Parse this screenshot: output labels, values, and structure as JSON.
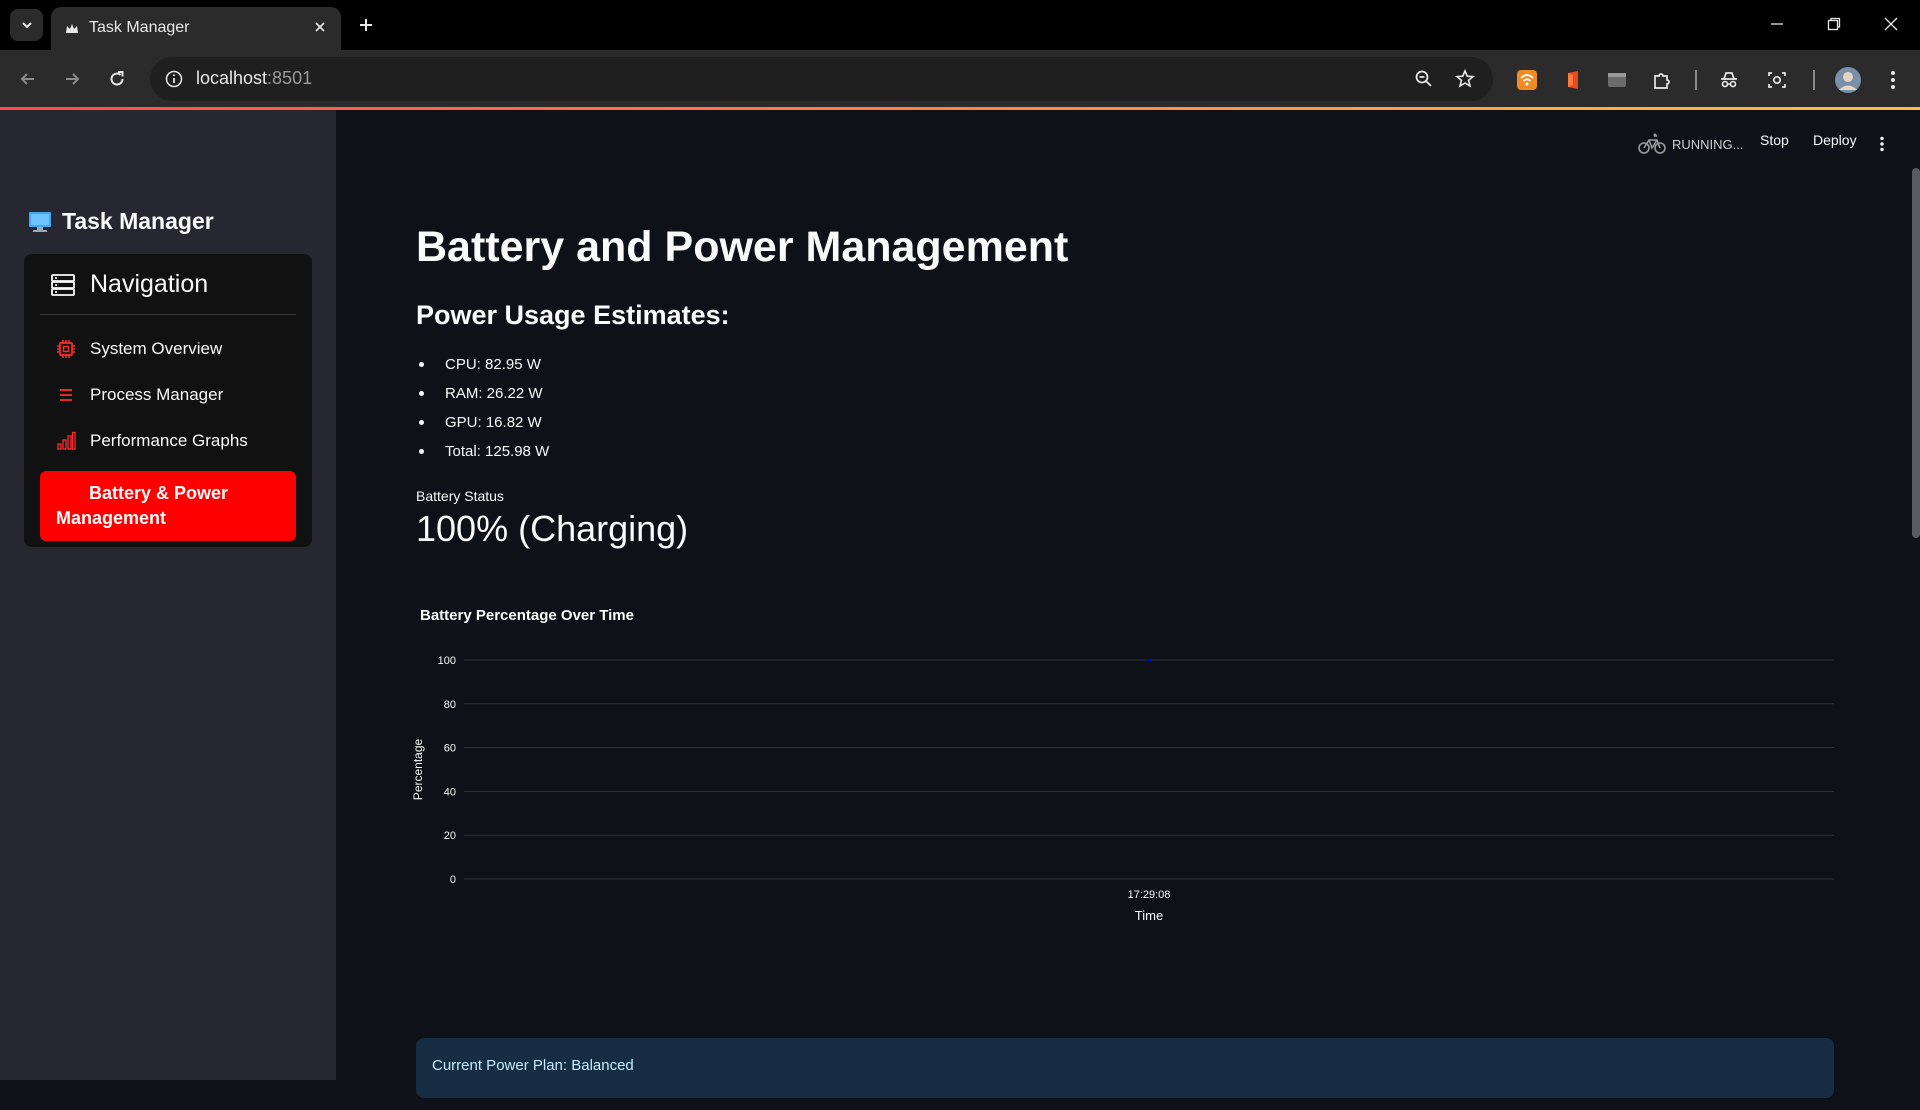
{
  "browser": {
    "tab_title": "Task Manager",
    "url_host": "localhost",
    "url_port": ":8501"
  },
  "app": {
    "status": "RUNNING...",
    "stop_label": "Stop",
    "deploy_label": "Deploy"
  },
  "sidebar": {
    "title": "Task Manager",
    "nav_header": "Navigation",
    "items": [
      {
        "label": "System Overview",
        "icon": "cpu-icon"
      },
      {
        "label": "Process Manager",
        "icon": "list-icon"
      },
      {
        "label": "Performance Graphs",
        "icon": "bar-chart-icon"
      },
      {
        "label": "Battery & Power Management",
        "icon": "",
        "active": true
      }
    ]
  },
  "main": {
    "title": "Battery and Power Management",
    "subtitle": "Power Usage Estimates:",
    "estimates": [
      "CPU: 82.95 W",
      "RAM: 26.22 W",
      "GPU: 16.82 W",
      "Total: 125.98 W"
    ],
    "battery_label": "Battery Status",
    "battery_value": "100% (Charging)",
    "power_plan": "Current Power Plan: Balanced"
  },
  "colors": {
    "accent": "#ff0000",
    "background": "#0e1117",
    "sidebar": "#262730",
    "info_box": "#172d43",
    "series": "#0000ff"
  },
  "chart_data": {
    "type": "line",
    "title": "Battery Percentage Over Time",
    "xlabel": "Time",
    "ylabel": "Percentage",
    "x": [
      "17:29:08"
    ],
    "y": [
      100
    ],
    "ylim": [
      0,
      100
    ],
    "yticks": [
      0,
      20,
      40,
      60,
      80,
      100
    ],
    "grid": true
  }
}
